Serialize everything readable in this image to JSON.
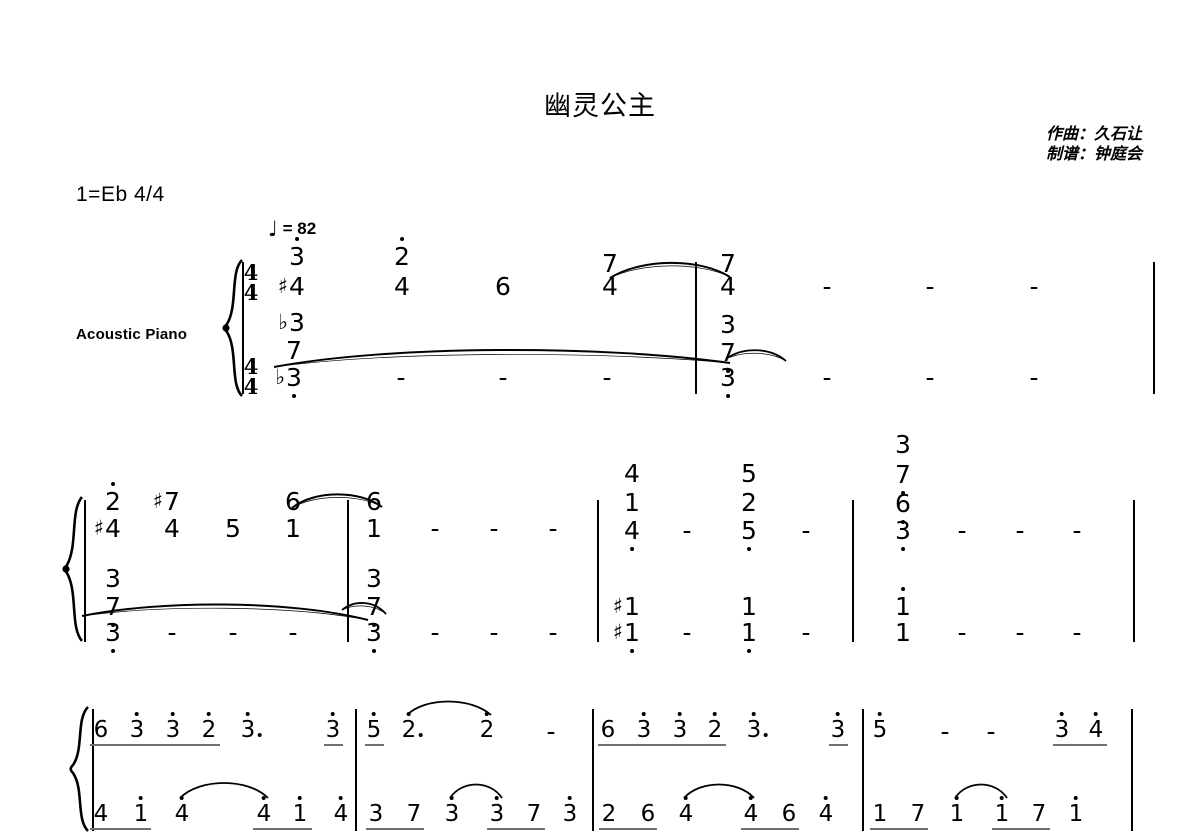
{
  "header": {
    "title": "幽灵公主",
    "composer_line": "作曲：久石让",
    "arranger_line": "制谱：钟庭会",
    "key_signature": "1=Eb 4/4",
    "tempo_note": "♩",
    "tempo_text": "= 82",
    "instrument": "Acoustic Piano",
    "time_signature_top": "4",
    "time_signature_bottom": "4"
  },
  "symbols": {
    "sharp": "♯",
    "flat": "♭",
    "dash": "-",
    "dot": "·"
  },
  "systems": [
    {
      "id": "system-1",
      "measures": [
        {
          "id": "s1-m1",
          "treble_chords": [
            {
              "stack": [
                "3",
                "4",
                "3"
              ],
              "accidentals": [
                "",
                "♯",
                "♭"
              ],
              "oct_up": [
                true,
                false,
                false
              ]
            },
            {
              "stack": [
                "2"
              ],
              "accidentals": [
                ""
              ],
              "oct_up": [
                true
              ]
            },
            {
              "stack": [
                "4"
              ],
              "accidentals": [
                ""
              ],
              "oct_up": [
                false
              ]
            },
            {
              "stack": [
                "6"
              ],
              "accidentals": [
                ""
              ],
              "oct_up": [
                false
              ]
            },
            {
              "stack": [
                "7",
                "4"
              ],
              "accidentals": [
                "",
                ""
              ],
              "oct_up": [
                false,
                false
              ]
            }
          ],
          "bass_chords": [
            {
              "stack": [
                "7",
                "3"
              ],
              "accidentals": [
                "",
                "♭"
              ],
              "oct_dn": [
                false,
                true
              ]
            },
            {
              "stack": [
                "-"
              ]
            },
            {
              "stack": [
                "-"
              ]
            },
            {
              "stack": [
                "-"
              ]
            }
          ]
        },
        {
          "id": "s1-m2",
          "treble_chords": [
            {
              "stack": [
                "7",
                "4"
              ],
              "accidentals": [
                "",
                ""
              ],
              "oct_up": [
                false,
                false
              ]
            },
            {
              "stack": [
                "-"
              ]
            },
            {
              "stack": [
                "-"
              ]
            },
            {
              "stack": [
                "-"
              ]
            }
          ],
          "bass_chords": [
            {
              "stack": [
                "3",
                "7",
                "3"
              ],
              "accidentals": [
                "",
                "",
                ""
              ],
              "oct_dn": [
                false,
                true,
                true
              ]
            },
            {
              "stack": [
                "-"
              ]
            },
            {
              "stack": [
                "-"
              ]
            },
            {
              "stack": [
                "-"
              ]
            }
          ]
        }
      ]
    },
    {
      "id": "system-2",
      "measures": [
        {
          "id": "s2-m1",
          "treble_chords": [
            {
              "stack": [
                "2",
                "4"
              ],
              "accidentals": [
                "",
                "♯"
              ],
              "oct_up": [
                true,
                false
              ]
            },
            {
              "stack": [
                "7",
                "4"
              ],
              "accidentals": [
                "♯",
                ""
              ],
              "oct_up": [
                false,
                false
              ]
            },
            {
              "stack": [
                "5"
              ],
              "accidentals": [
                ""
              ]
            },
            {
              "stack": [
                "6",
                "1"
              ],
              "accidentals": [
                "",
                ""
              ]
            }
          ],
          "bass_chords": [
            {
              "stack": [
                "3",
                "7",
                "3"
              ],
              "accidentals": [
                "",
                "",
                ""
              ],
              "oct_dn": [
                false,
                true,
                true
              ]
            },
            {
              "stack": [
                "-"
              ]
            },
            {
              "stack": [
                "-"
              ]
            },
            {
              "stack": [
                "-"
              ]
            }
          ]
        },
        {
          "id": "s2-m2",
          "treble_chords": [
            {
              "stack": [
                "6",
                "1"
              ],
              "accidentals": [
                "",
                ""
              ]
            },
            {
              "stack": [
                "-"
              ]
            },
            {
              "stack": [
                "-"
              ]
            },
            {
              "stack": [
                "-"
              ]
            }
          ],
          "bass_chords": [
            {
              "stack": [
                "3",
                "7",
                "3"
              ],
              "accidentals": [
                "",
                "",
                ""
              ],
              "oct_dn": [
                false,
                true,
                true
              ]
            },
            {
              "stack": [
                "-"
              ]
            },
            {
              "stack": [
                "-"
              ]
            },
            {
              "stack": [
                "-"
              ]
            }
          ]
        },
        {
          "id": "s2-m3",
          "treble_chords": [
            {
              "stack": [
                "4",
                "1",
                "4"
              ],
              "accidentals": [
                "",
                "",
                ""
              ],
              "oct_dn": [
                false,
                false,
                true
              ]
            },
            {
              "stack": [
                "-"
              ]
            },
            {
              "stack": [
                "5",
                "2",
                "5"
              ],
              "accidentals": [
                "",
                "",
                ""
              ],
              "oct_dn": [
                false,
                false,
                true
              ]
            },
            {
              "stack": [
                "-"
              ]
            }
          ],
          "bass_chords": [
            {
              "stack": [
                "1",
                "1"
              ],
              "accidentals": [
                "♯",
                "♯"
              ],
              "oct_dn": [
                false,
                true
              ]
            },
            {
              "stack": [
                "-"
              ]
            },
            {
              "stack": [
                "1",
                "1"
              ],
              "accidentals": [
                "",
                ""
              ],
              "oct_dn": [
                false,
                true
              ]
            },
            {
              "stack": [
                "-"
              ]
            }
          ]
        },
        {
          "id": "s2-m4",
          "treble_chords": [
            {
              "stack": [
                "3",
                "7",
                "6",
                "3"
              ],
              "accidentals": [
                "",
                "",
                "",
                ""
              ],
              "oct_dn": [
                false,
                true,
                true,
                true
              ]
            },
            {
              "stack": [
                "-"
              ]
            },
            {
              "stack": [
                "-"
              ]
            },
            {
              "stack": [
                "-"
              ]
            }
          ],
          "bass_chords": [
            {
              "stack": [
                "1",
                "1"
              ],
              "accidentals": [
                "",
                ""
              ],
              "oct_up": [
                true,
                false
              ]
            },
            {
              "stack": [
                "-"
              ]
            },
            {
              "stack": [
                "-"
              ]
            },
            {
              "stack": [
                "-"
              ]
            }
          ]
        }
      ]
    },
    {
      "id": "system-3",
      "measures": [
        {
          "id": "s3-m1",
          "treble_notes": [
            "6",
            "3",
            "3",
            "2",
            "3",
            "3"
          ],
          "treble_oct_up": [
            false,
            true,
            true,
            true,
            true,
            true
          ],
          "treble_dotted": [
            false,
            false,
            false,
            false,
            true,
            false
          ],
          "bass_notes": [
            "4",
            "1",
            "4",
            "4",
            "1",
            "4"
          ],
          "bass_oct_up": [
            false,
            true,
            true,
            true,
            true,
            true
          ]
        },
        {
          "id": "s3-m2",
          "treble_notes": [
            "5",
            "2",
            "2",
            "-"
          ],
          "treble_oct_up": [
            true,
            true,
            true,
            false
          ],
          "treble_dotted": [
            false,
            true,
            false,
            false
          ],
          "bass_notes": [
            "3",
            "7",
            "3",
            "3",
            "7",
            "3"
          ],
          "bass_oct_up": [
            false,
            false,
            true,
            true,
            false,
            true
          ]
        },
        {
          "id": "s3-m3",
          "treble_notes": [
            "6",
            "3",
            "3",
            "2",
            "3",
            "3"
          ],
          "treble_oct_up": [
            false,
            true,
            true,
            true,
            true,
            true
          ],
          "treble_dotted": [
            false,
            false,
            false,
            false,
            true,
            false
          ],
          "bass_notes": [
            "2",
            "6",
            "4",
            "4",
            "6",
            "4"
          ],
          "bass_oct_up": [
            false,
            false,
            true,
            true,
            false,
            true
          ]
        },
        {
          "id": "s3-m4",
          "treble_notes": [
            "5",
            "-",
            "-",
            "3",
            "4"
          ],
          "treble_oct_up": [
            true,
            false,
            false,
            true,
            true
          ],
          "treble_dotted": [
            false,
            false,
            false,
            false,
            false
          ],
          "bass_notes": [
            "1",
            "7",
            "1",
            "1",
            "7",
            "1"
          ],
          "bass_oct_up": [
            false,
            false,
            true,
            true,
            false,
            true
          ]
        }
      ]
    }
  ]
}
